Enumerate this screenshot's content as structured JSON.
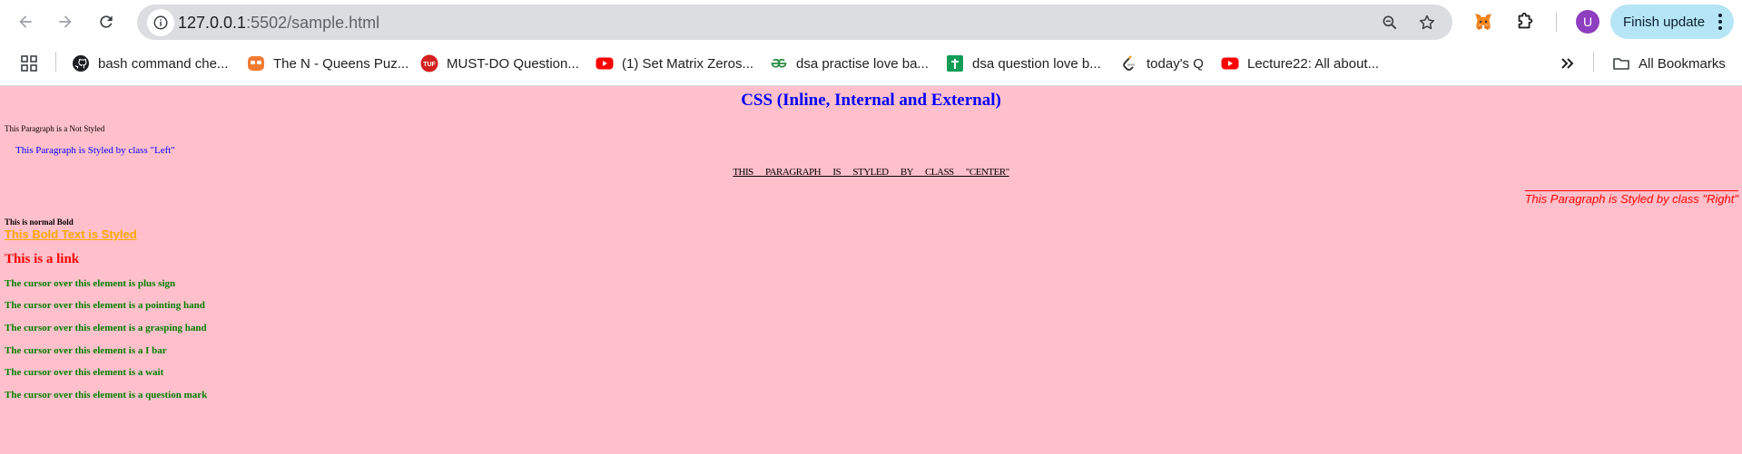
{
  "browser": {
    "url_host": "127.0.0.1",
    "url_rest": ":5502/sample.html",
    "profile_initial": "U",
    "finish_update_label": "Finish update",
    "all_bookmarks_label": "All Bookmarks",
    "bookmarks": [
      {
        "label": "bash command che...",
        "icon": "github-icon"
      },
      {
        "label": "The N - Queens Puz...",
        "icon": "codingninjas-icon"
      },
      {
        "label": "MUST-DO Question...",
        "icon": "tuf-icon"
      },
      {
        "label": "(1) Set Matrix Zeros...",
        "icon": "youtube-icon"
      },
      {
        "label": "dsa practise love ba...",
        "icon": "geeksforgeeks-icon"
      },
      {
        "label": "dsa question love b...",
        "icon": "google-sheets-icon"
      },
      {
        "label": "today's Q",
        "icon": "leetcode-icon"
      },
      {
        "label": "Lecture22: All about...",
        "icon": "youtube-icon"
      }
    ]
  },
  "page": {
    "heading": "CSS (Inline, Internal and External)",
    "plain_paragraph": "This Paragraph is a Not Styled",
    "left_paragraph": "This Paragraph is Styled by class \"Left\"",
    "center_paragraph": "This Paragraph is Styled by class \"Center\"",
    "right_paragraph": "This Paragraph is Styled by class \"Right\"",
    "normal_bold": "This is normal Bold",
    "styled_bold": "This Bold Text is Styled",
    "link_text": "This is a link",
    "cursor_lines": [
      "The cursor over this element is plus sign",
      "The cursor over this element is a pointing hand",
      "The cursor over this element is a grasping hand",
      "The cursor over this element is a I bar",
      "The cursor over this element is a wait",
      "The cursor over this element is a question mark"
    ]
  }
}
